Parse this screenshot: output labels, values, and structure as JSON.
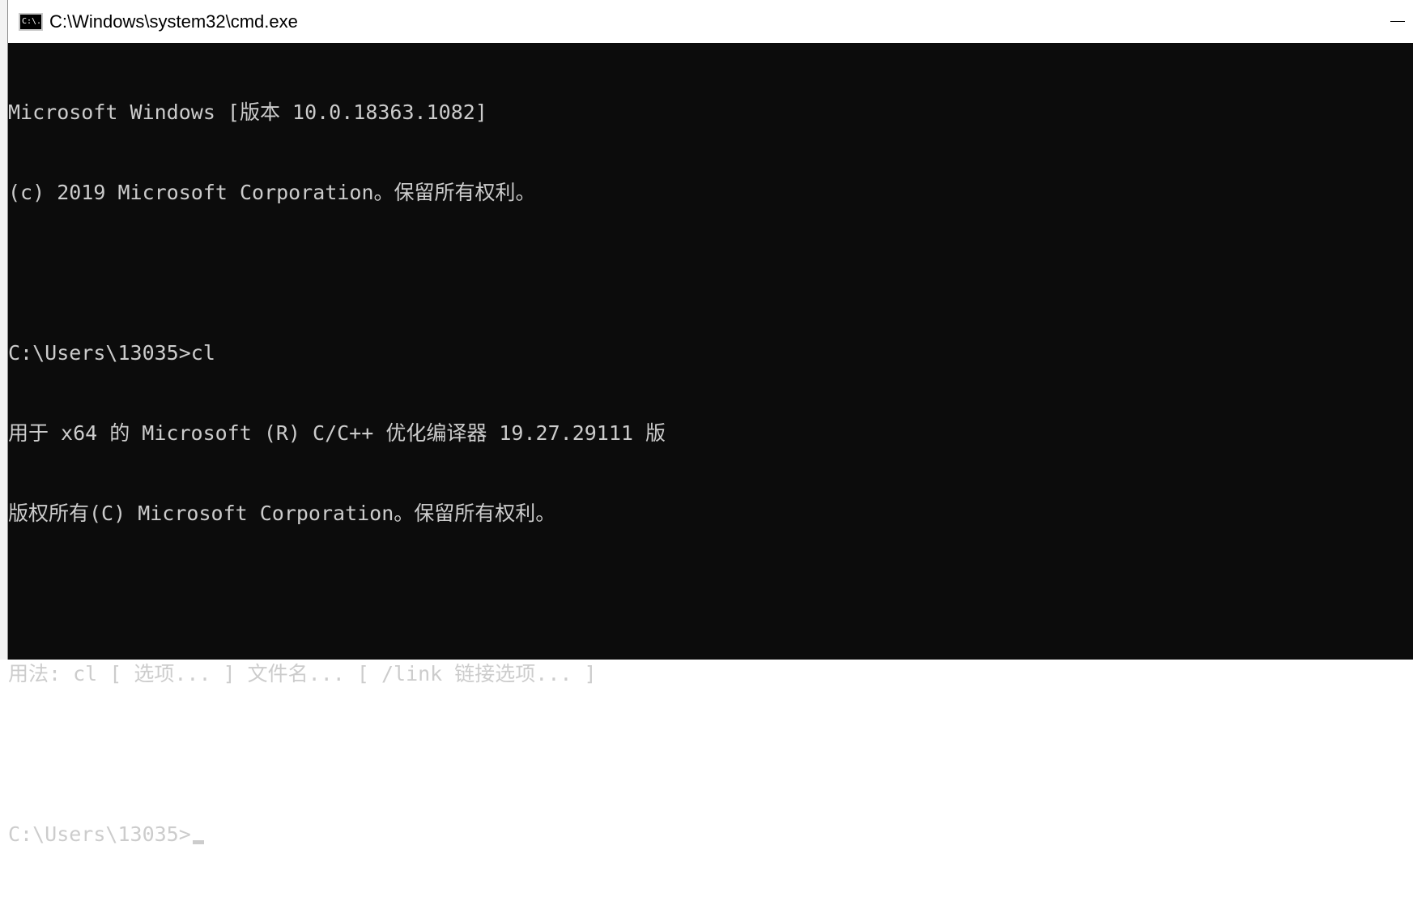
{
  "window": {
    "title": "C:\\Windows\\system32\\cmd.exe",
    "icon_label": "C:\\."
  },
  "console": {
    "lines": [
      "Microsoft Windows [版本 10.0.18363.1082]",
      "(c) 2019 Microsoft Corporation。保留所有权利。",
      "",
      "C:\\Users\\13035>cl",
      "用于 x64 的 Microsoft (R) C/C++ 优化编译器 19.27.29111 版",
      "版权所有(C) Microsoft Corporation。保留所有权利。",
      "",
      "用法: cl [ 选项... ] 文件名... [ /link 链接选项... ]",
      "",
      "C:\\Users\\13035>"
    ]
  },
  "colors": {
    "console_bg": "#0c0c0c",
    "console_fg": "#cccccc",
    "titlebar_bg": "#ffffff"
  },
  "icons": {
    "app": "cmd-app-icon",
    "minimize": "minimize-icon"
  }
}
